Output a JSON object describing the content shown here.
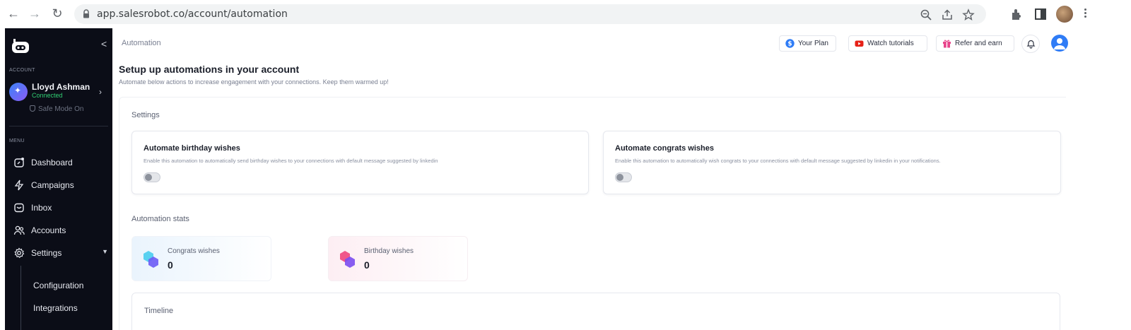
{
  "browser": {
    "url": "app.salesrobot.co/account/automation"
  },
  "sidebar": {
    "account_section": "ACCOUNT",
    "account_name": "Lloyd Ashman",
    "account_status": "Connected",
    "safe_mode": "Safe Mode On",
    "menu_section": "MENU",
    "items": [
      {
        "label": "Dashboard",
        "icon": "dashboard-icon"
      },
      {
        "label": "Campaigns",
        "icon": "lightning-icon"
      },
      {
        "label": "Inbox",
        "icon": "inbox-icon"
      },
      {
        "label": "Accounts",
        "icon": "users-icon"
      },
      {
        "label": "Settings",
        "icon": "gear-icon"
      }
    ],
    "sub_items": [
      {
        "label": "Configuration"
      },
      {
        "label": "Integrations"
      }
    ]
  },
  "header": {
    "breadcrumb": "Automation",
    "your_plan": "Your Plan",
    "watch_tutorials": "Watch tutorials",
    "refer_earn": "Refer and earn"
  },
  "page": {
    "title": "Setup up automations in your account",
    "subtitle": "Automate below actions to increase engagement with your connections. Keep them warmed up!",
    "settings_title": "Settings",
    "birthday_card": {
      "title": "Automate birthday wishes",
      "desc": "Enable this automation to automatically send birthday wishes to your connections with default message suggested by linkedin",
      "enabled": false
    },
    "congrats_card": {
      "title": "Automate congrats wishes",
      "desc": "Enable this automation to automatically wish congrats to your connections with default message suggested by linkedin in your notifications.",
      "enabled": false
    },
    "stats_title": "Automation stats",
    "stats": {
      "congrats_label": "Congrats wishes",
      "congrats_value": "0",
      "birthday_label": "Birthday wishes",
      "birthday_value": "0"
    },
    "timeline_title": "Timeline"
  },
  "colors": {
    "sidebar_bg": "#0b0d17",
    "accent_blue": "#2f7cf6",
    "connected_green": "#2fcf72",
    "youtube_red": "#e62117",
    "gift_pink": "#e8458b"
  }
}
